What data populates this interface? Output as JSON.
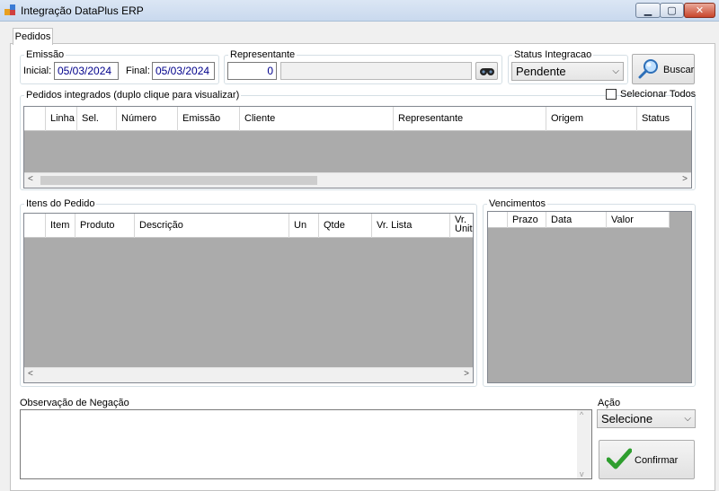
{
  "window": {
    "title": "Integração DataPlus ERP",
    "minimize": "▁",
    "maximize": "▢",
    "close": "✕"
  },
  "tabs": [
    {
      "label": "Pedidos"
    }
  ],
  "emissao": {
    "group_label": "Emissão",
    "inicial_label": "Inicial:",
    "inicial_value": "05/03/2024",
    "final_label": "Final:",
    "final_value": "05/03/2024"
  },
  "representante": {
    "group_label": "Representante",
    "code": "0",
    "name": ""
  },
  "status": {
    "group_label": "Status Integracao",
    "selected": "Pendente"
  },
  "buscar": {
    "label": "Buscar",
    "icon": "magnifier-icon"
  },
  "pedidos": {
    "group_label": "Pedidos integrados (duplo clique para visualizar)",
    "select_all_label": "Selecionar Todos",
    "select_all_checked": false,
    "columns": [
      "Linha",
      "Sel.",
      "Número",
      "Emissão",
      "Cliente",
      "Representante",
      "Origem",
      "Status"
    ]
  },
  "itens": {
    "group_label": "Itens do Pedido",
    "columns": [
      "Item",
      "Produto",
      "Descrição",
      "Un",
      "Qtde",
      "Vr. Lista",
      "Vr. Unit."
    ]
  },
  "vencimentos": {
    "group_label": "Vencimentos",
    "columns": [
      "Prazo",
      "Data",
      "Valor"
    ]
  },
  "observacao": {
    "label": "Observação de Negação",
    "value": ""
  },
  "acao": {
    "label": "Ação",
    "selected": "Selecione"
  },
  "confirmar": {
    "label": "Confirmar",
    "icon": "checkmark-icon"
  },
  "colors": {
    "grid_bg": "#ababab",
    "input_text": "#00008b"
  }
}
